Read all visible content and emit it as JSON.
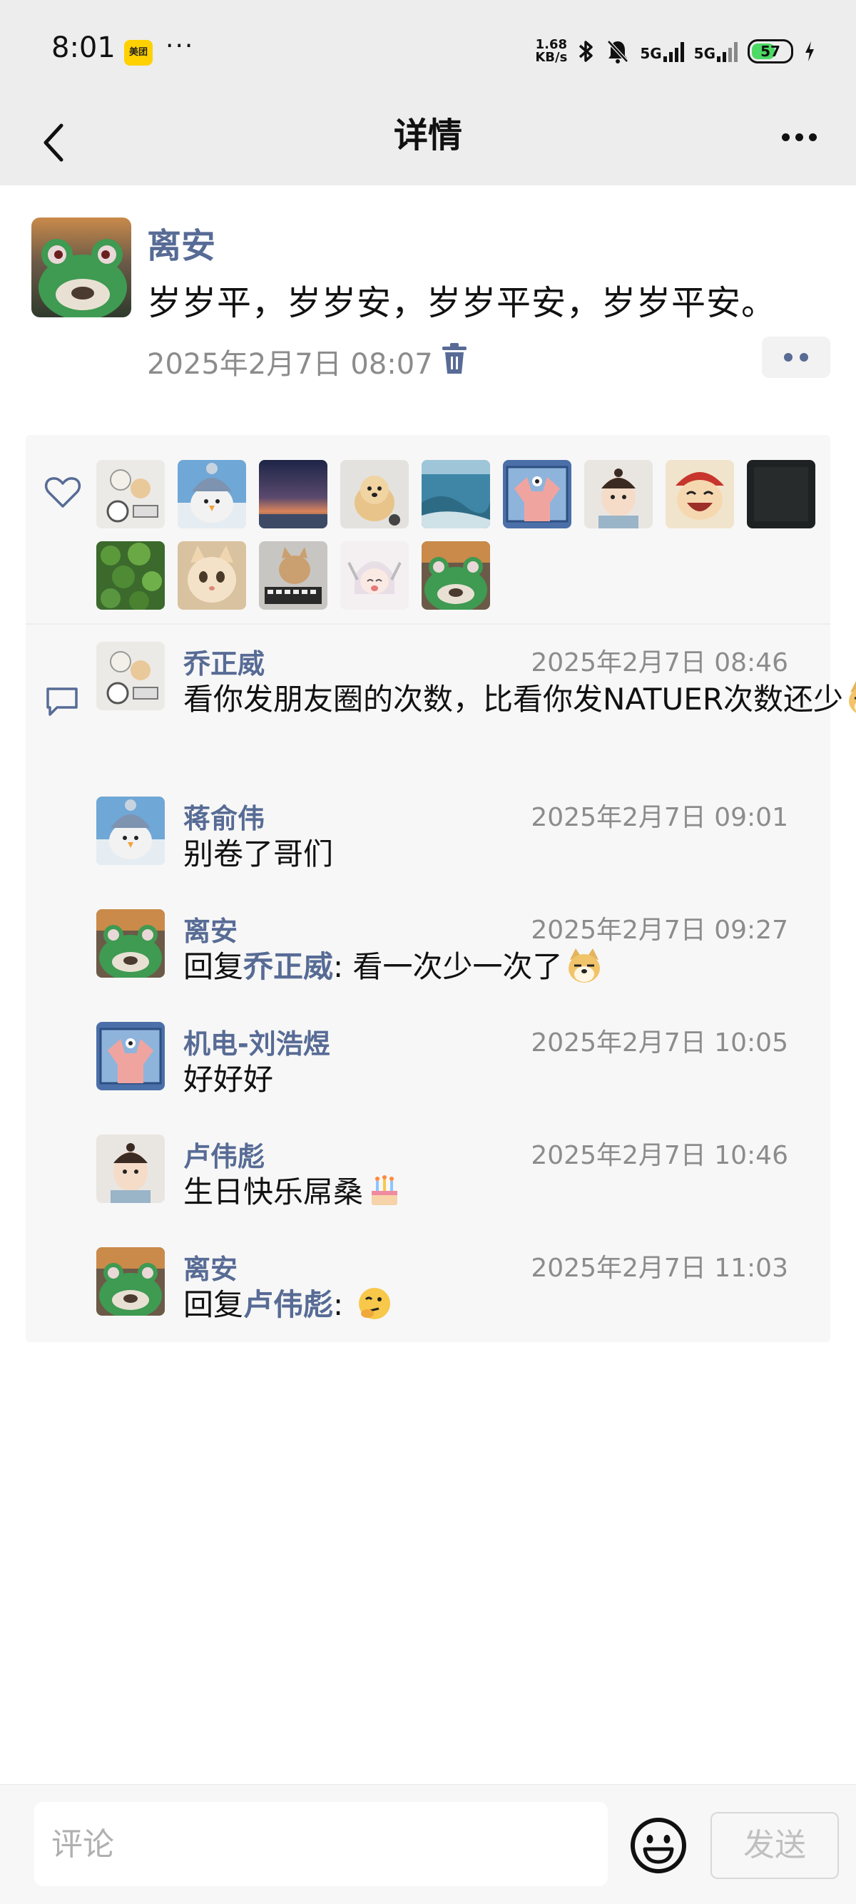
{
  "status_bar": {
    "time": "8:01",
    "app_badge": "美团",
    "more": "···",
    "net_speed_top": "1.68",
    "net_speed_unit": "KB/s",
    "signal_label_1": "5G",
    "signal_label_2": "5G",
    "battery": "57"
  },
  "nav": {
    "title": "详情"
  },
  "post": {
    "author": "离安",
    "text": "岁岁平，岁岁安，岁岁平安，岁岁平安。",
    "time": "2025年2月7日 08:07"
  },
  "likes": [
    {
      "avatar": "cats-scale-avatar"
    },
    {
      "avatar": "penguin-hat-avatar"
    },
    {
      "avatar": "sunset-sky-avatar"
    },
    {
      "avatar": "golden-dog-avatar"
    },
    {
      "avatar": "sea-coast-avatar"
    },
    {
      "avatar": "patrick-star-avatar"
    },
    {
      "avatar": "baby-photo-avatar"
    },
    {
      "avatar": "cartoon-laugh-avatar"
    },
    {
      "avatar": "dark-avatar"
    },
    {
      "avatar": "green-plants-avatar"
    },
    {
      "avatar": "kitten-avatar"
    },
    {
      "avatar": "cat-keyboard-avatar"
    },
    {
      "avatar": "anime-girl-avatar"
    },
    {
      "avatar": "frog-avatar"
    }
  ],
  "comments": [
    {
      "name": "乔正威",
      "time": "2025年2月7日 08:46",
      "prefix": "",
      "reply_to": "",
      "text": "看你发朋友圈的次数，比看你发NATUER次数还少",
      "emoji": "doge",
      "avatar": "cats-scale-avatar"
    },
    {
      "name": "蒋俞伟",
      "time": "2025年2月7日 09:01",
      "prefix": "",
      "reply_to": "",
      "text": "别卷了哥们",
      "emoji": "",
      "avatar": "penguin-hat-avatar"
    },
    {
      "name": "离安",
      "time": "2025年2月7日 09:27",
      "prefix": "回复",
      "reply_to": "乔正威",
      "text": ": 看一次少一次了",
      "emoji": "doge",
      "avatar": "frog-avatar"
    },
    {
      "name": "机电-刘浩煜",
      "time": "2025年2月7日 10:05",
      "prefix": "",
      "reply_to": "",
      "text": "好好好",
      "emoji": "",
      "avatar": "patrick-star-avatar"
    },
    {
      "name": "卢伟彪",
      "time": "2025年2月7日 10:46",
      "prefix": "",
      "reply_to": "",
      "text": "生日快乐屌桑",
      "emoji": "cake",
      "avatar": "baby-photo-avatar"
    },
    {
      "name": "离安",
      "time": "2025年2月7日 11:03",
      "prefix": "回复",
      "reply_to": "卢伟彪",
      "text": ": ",
      "emoji": "thinking",
      "avatar": "frog-avatar"
    }
  ],
  "input": {
    "placeholder": "评论",
    "send_label": "发送"
  },
  "colors": {
    "link": "#576b95",
    "meta": "#8c8c8c",
    "bar_bg": "#ededed",
    "box_bg": "#f7f7f7"
  }
}
